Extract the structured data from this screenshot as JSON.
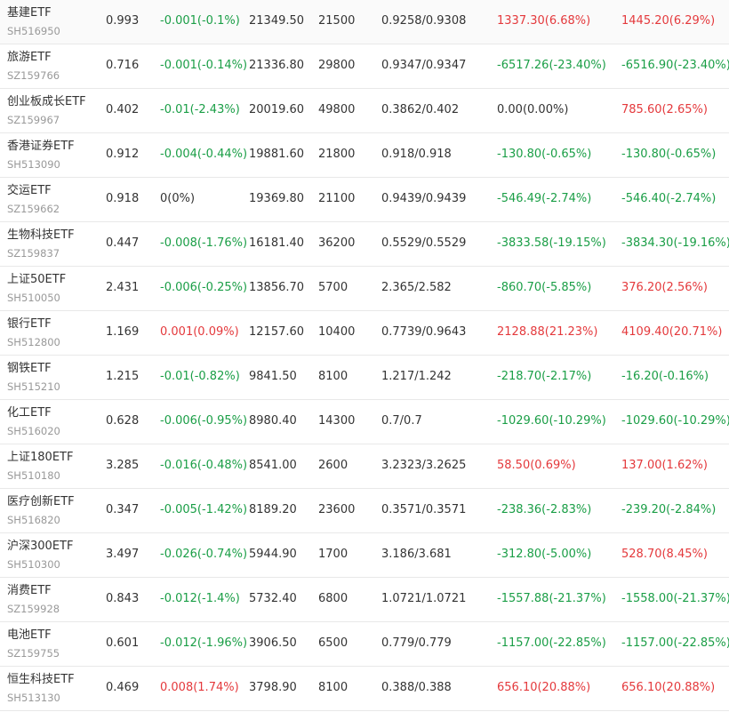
{
  "colors": {
    "up": "#e4393c",
    "down": "#1a9e46",
    "flat": "#333333",
    "code": "#999999",
    "divider": "#e8e8e8"
  },
  "rows": [
    {
      "name": "基建ETF",
      "code": "SH516950",
      "price": "0.993",
      "change": "-0.001(-0.1%)",
      "change_dir": "down",
      "market_value": "21349.50",
      "shares": "21500",
      "cost": "0.9258/0.9308",
      "today_pl": "1337.30(6.68%)",
      "today_dir": "up",
      "total_pl": "1445.20(6.29%)",
      "total_dir": "up"
    },
    {
      "name": "旅游ETF",
      "code": "SZ159766",
      "price": "0.716",
      "change": "-0.001(-0.14%)",
      "change_dir": "down",
      "market_value": "21336.80",
      "shares": "29800",
      "cost": "0.9347/0.9347",
      "today_pl": "-6517.26(-23.40%)",
      "today_dir": "down",
      "total_pl": "-6516.90(-23.40%)",
      "total_dir": "down"
    },
    {
      "name": "创业板成长ETF",
      "code": "SZ159967",
      "price": "0.402",
      "change": "-0.01(-2.43%)",
      "change_dir": "down",
      "market_value": "20019.60",
      "shares": "49800",
      "cost": "0.3862/0.402",
      "today_pl": "0.00(0.00%)",
      "today_dir": "flat",
      "total_pl": "785.60(2.65%)",
      "total_dir": "up"
    },
    {
      "name": "香港证券ETF",
      "code": "SH513090",
      "price": "0.912",
      "change": "-0.004(-0.44%)",
      "change_dir": "down",
      "market_value": "19881.60",
      "shares": "21800",
      "cost": "0.918/0.918",
      "today_pl": "-130.80(-0.65%)",
      "today_dir": "down",
      "total_pl": "-130.80(-0.65%)",
      "total_dir": "down"
    },
    {
      "name": "交运ETF",
      "code": "SZ159662",
      "price": "0.918",
      "change": "0(0%)",
      "change_dir": "flat",
      "market_value": "19369.80",
      "shares": "21100",
      "cost": "0.9439/0.9439",
      "today_pl": "-546.49(-2.74%)",
      "today_dir": "down",
      "total_pl": "-546.40(-2.74%)",
      "total_dir": "down"
    },
    {
      "name": "生物科技ETF",
      "code": "SZ159837",
      "price": "0.447",
      "change": "-0.008(-1.76%)",
      "change_dir": "down",
      "market_value": "16181.40",
      "shares": "36200",
      "cost": "0.5529/0.5529",
      "today_pl": "-3833.58(-19.15%)",
      "today_dir": "down",
      "total_pl": "-3834.30(-19.16%)",
      "total_dir": "down"
    },
    {
      "name": "上证50ETF",
      "code": "SH510050",
      "price": "2.431",
      "change": "-0.006(-0.25%)",
      "change_dir": "down",
      "market_value": "13856.70",
      "shares": "5700",
      "cost": "2.365/2.582",
      "today_pl": "-860.70(-5.85%)",
      "today_dir": "down",
      "total_pl": "376.20(2.56%)",
      "total_dir": "up"
    },
    {
      "name": "银行ETF",
      "code": "SH512800",
      "price": "1.169",
      "change": "0.001(0.09%)",
      "change_dir": "up",
      "market_value": "12157.60",
      "shares": "10400",
      "cost": "0.7739/0.9643",
      "today_pl": "2128.88(21.23%)",
      "today_dir": "up",
      "total_pl": "4109.40(20.71%)",
      "total_dir": "up"
    },
    {
      "name": "钢铁ETF",
      "code": "SH515210",
      "price": "1.215",
      "change": "-0.01(-0.82%)",
      "change_dir": "down",
      "market_value": "9841.50",
      "shares": "8100",
      "cost": "1.217/1.242",
      "today_pl": "-218.70(-2.17%)",
      "today_dir": "down",
      "total_pl": "-16.20(-0.16%)",
      "total_dir": "down"
    },
    {
      "name": "化工ETF",
      "code": "SH516020",
      "price": "0.628",
      "change": "-0.006(-0.95%)",
      "change_dir": "down",
      "market_value": "8980.40",
      "shares": "14300",
      "cost": "0.7/0.7",
      "today_pl": "-1029.60(-10.29%)",
      "today_dir": "down",
      "total_pl": "-1029.60(-10.29%)",
      "total_dir": "down"
    },
    {
      "name": "上证180ETF",
      "code": "SH510180",
      "price": "3.285",
      "change": "-0.016(-0.48%)",
      "change_dir": "down",
      "market_value": "8541.00",
      "shares": "2600",
      "cost": "3.2323/3.2625",
      "today_pl": "58.50(0.69%)",
      "today_dir": "up",
      "total_pl": "137.00(1.62%)",
      "total_dir": "up"
    },
    {
      "name": "医疗创新ETF",
      "code": "SH516820",
      "price": "0.347",
      "change": "-0.005(-1.42%)",
      "change_dir": "down",
      "market_value": "8189.20",
      "shares": "23600",
      "cost": "0.3571/0.3571",
      "today_pl": "-238.36(-2.83%)",
      "today_dir": "down",
      "total_pl": "-239.20(-2.84%)",
      "total_dir": "down"
    },
    {
      "name": "沪深300ETF",
      "code": "SH510300",
      "price": "3.497",
      "change": "-0.026(-0.74%)",
      "change_dir": "down",
      "market_value": "5944.90",
      "shares": "1700",
      "cost": "3.186/3.681",
      "today_pl": "-312.80(-5.00%)",
      "today_dir": "down",
      "total_pl": "528.70(8.45%)",
      "total_dir": "up"
    },
    {
      "name": "消费ETF",
      "code": "SZ159928",
      "price": "0.843",
      "change": "-0.012(-1.4%)",
      "change_dir": "down",
      "market_value": "5732.40",
      "shares": "6800",
      "cost": "1.0721/1.0721",
      "today_pl": "-1557.88(-21.37%)",
      "today_dir": "down",
      "total_pl": "-1558.00(-21.37%)",
      "total_dir": "down"
    },
    {
      "name": "电池ETF",
      "code": "SZ159755",
      "price": "0.601",
      "change": "-0.012(-1.96%)",
      "change_dir": "down",
      "market_value": "3906.50",
      "shares": "6500",
      "cost": "0.779/0.779",
      "today_pl": "-1157.00(-22.85%)",
      "today_dir": "down",
      "total_pl": "-1157.00(-22.85%)",
      "total_dir": "down"
    },
    {
      "name": "恒生科技ETF",
      "code": "SH513130",
      "price": "0.469",
      "change": "0.008(1.74%)",
      "change_dir": "up",
      "market_value": "3798.90",
      "shares": "8100",
      "cost": "0.388/0.388",
      "today_pl": "656.10(20.88%)",
      "today_dir": "up",
      "total_pl": "656.10(20.88%)",
      "total_dir": "up"
    }
  ]
}
